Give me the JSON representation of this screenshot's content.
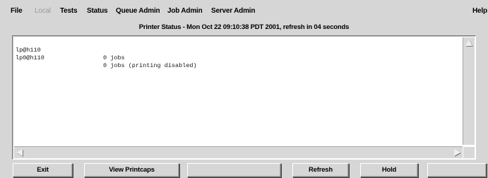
{
  "menubar": {
    "file": "File",
    "local": "Local",
    "tests": "Tests",
    "status": "Status",
    "queue_admin": "Queue Admin",
    "job_admin": "Job Admin",
    "server_admin": "Server Admin",
    "help": "Help"
  },
  "status_line": "Printer Status - Mon Oct 22 09:10:38 PDT 2001, refresh in 04 seconds",
  "printers": [
    {
      "name": "lp@h110",
      "jobs": "0 jobs"
    },
    {
      "name": "lp0@h110",
      "jobs": "0 jobs (printing disabled)"
    }
  ],
  "buttons": {
    "exit": "Exit",
    "view_printcaps": "View Printcaps",
    "blank1": "",
    "refresh": "Refresh",
    "hold": "Hold",
    "blank2": ""
  }
}
